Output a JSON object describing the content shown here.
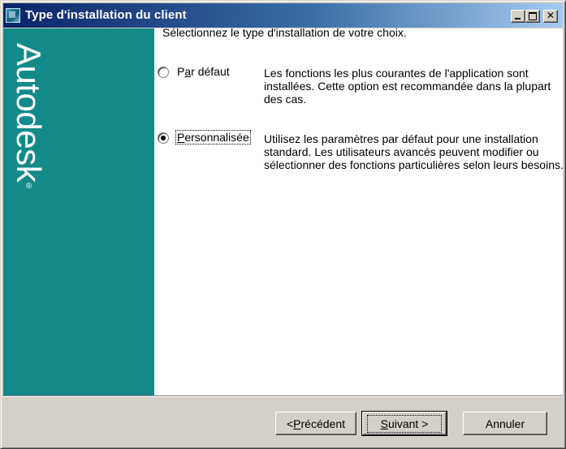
{
  "window": {
    "title": "Type d'installation du client",
    "controls": {
      "minimize": "_",
      "maximize": "□",
      "close": "✕"
    }
  },
  "brand": {
    "name": "Autodesk",
    "mark": "®"
  },
  "prompt": "Sélectionnez le type d'installation de votre choix.",
  "options": [
    {
      "label_prefix": "P",
      "label_underlined": "a",
      "label_suffix": "r défaut",
      "selected": false,
      "description": "Les fonctions les plus courantes de l'application sont installées. Cette option est recommandée dans la plupart des cas."
    },
    {
      "label_prefix": "",
      "label_underlined": "P",
      "label_suffix": "ersonnalisée",
      "selected": true,
      "description": "Utilisez les paramètres par défaut pour une installation standard. Les utilisateurs avancés peuvent modifier ou sélectionner des fonctions particulières selon leurs besoins."
    }
  ],
  "buttons": {
    "previous": {
      "prefix": "< ",
      "underlined": "P",
      "suffix": "récédent"
    },
    "next": {
      "prefix": "",
      "underlined": "S",
      "suffix": "uivant >"
    },
    "cancel": {
      "label": "Annuler"
    }
  }
}
